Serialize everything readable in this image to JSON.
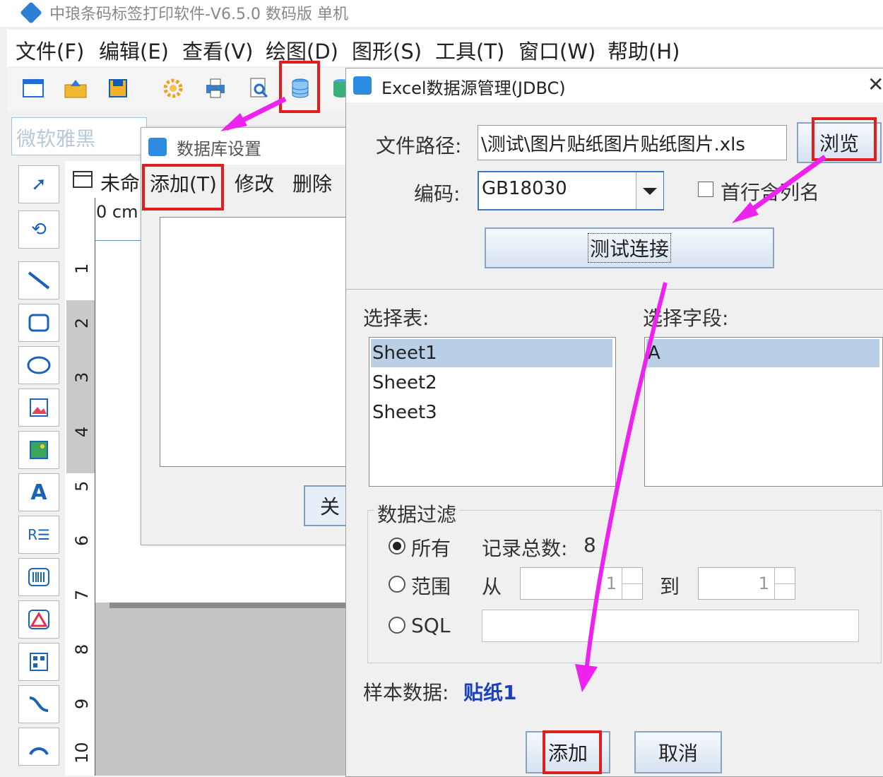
{
  "app": {
    "title": "中琅条码标签打印软件-V6.5.0 数码版 单机"
  },
  "menu": [
    "文件(F)",
    "编辑(E)",
    "查看(V)",
    "绘图(D)",
    "图形(S)",
    "工具(T)",
    "窗口(W)",
    "帮助(H)"
  ],
  "font": {
    "value": "微软雅黑"
  },
  "document": {
    "tab": "未命",
    "ruler_unit": "0 cm",
    "ruler_numbers": [
      "1",
      "2",
      "3",
      "4",
      "5",
      "6",
      "7",
      "8",
      "9",
      "10"
    ]
  },
  "db_dialog": {
    "title": "数据库设置",
    "add": "添加(T)",
    "modify": "修改",
    "delete": "删除",
    "close": "关"
  },
  "excel_dialog": {
    "title": "Excel数据源管理(JDBC)",
    "file_path_label": "文件路径:",
    "file_path_value": "\\测试\\图片贴纸图片贴纸图片.xls",
    "browse": "浏览",
    "encoding_label": "编码:",
    "encoding_value": "GB18030",
    "first_row_label": "首行含列名",
    "test_connection": "测试连接",
    "select_table_label": "选择表:",
    "tables": [
      "Sheet1",
      "Sheet2",
      "Sheet3"
    ],
    "select_field_label": "选择字段:",
    "fields": [
      "A"
    ],
    "filter_label": "数据过滤",
    "all_label": "所有",
    "total_label": "记录总数:",
    "total_value": "8",
    "range_label": "范围",
    "from_label": "从",
    "from_value": "1",
    "to_label": "到",
    "to_value": "1",
    "sql_label": "SQL",
    "sample_label": "样本数据:",
    "sample_value": "贴纸1",
    "add": "添加",
    "cancel": "取消"
  },
  "colors": {
    "highlight": "#e01e1e",
    "arrow": "#ee22ee",
    "sample": "#1a3fc0"
  }
}
